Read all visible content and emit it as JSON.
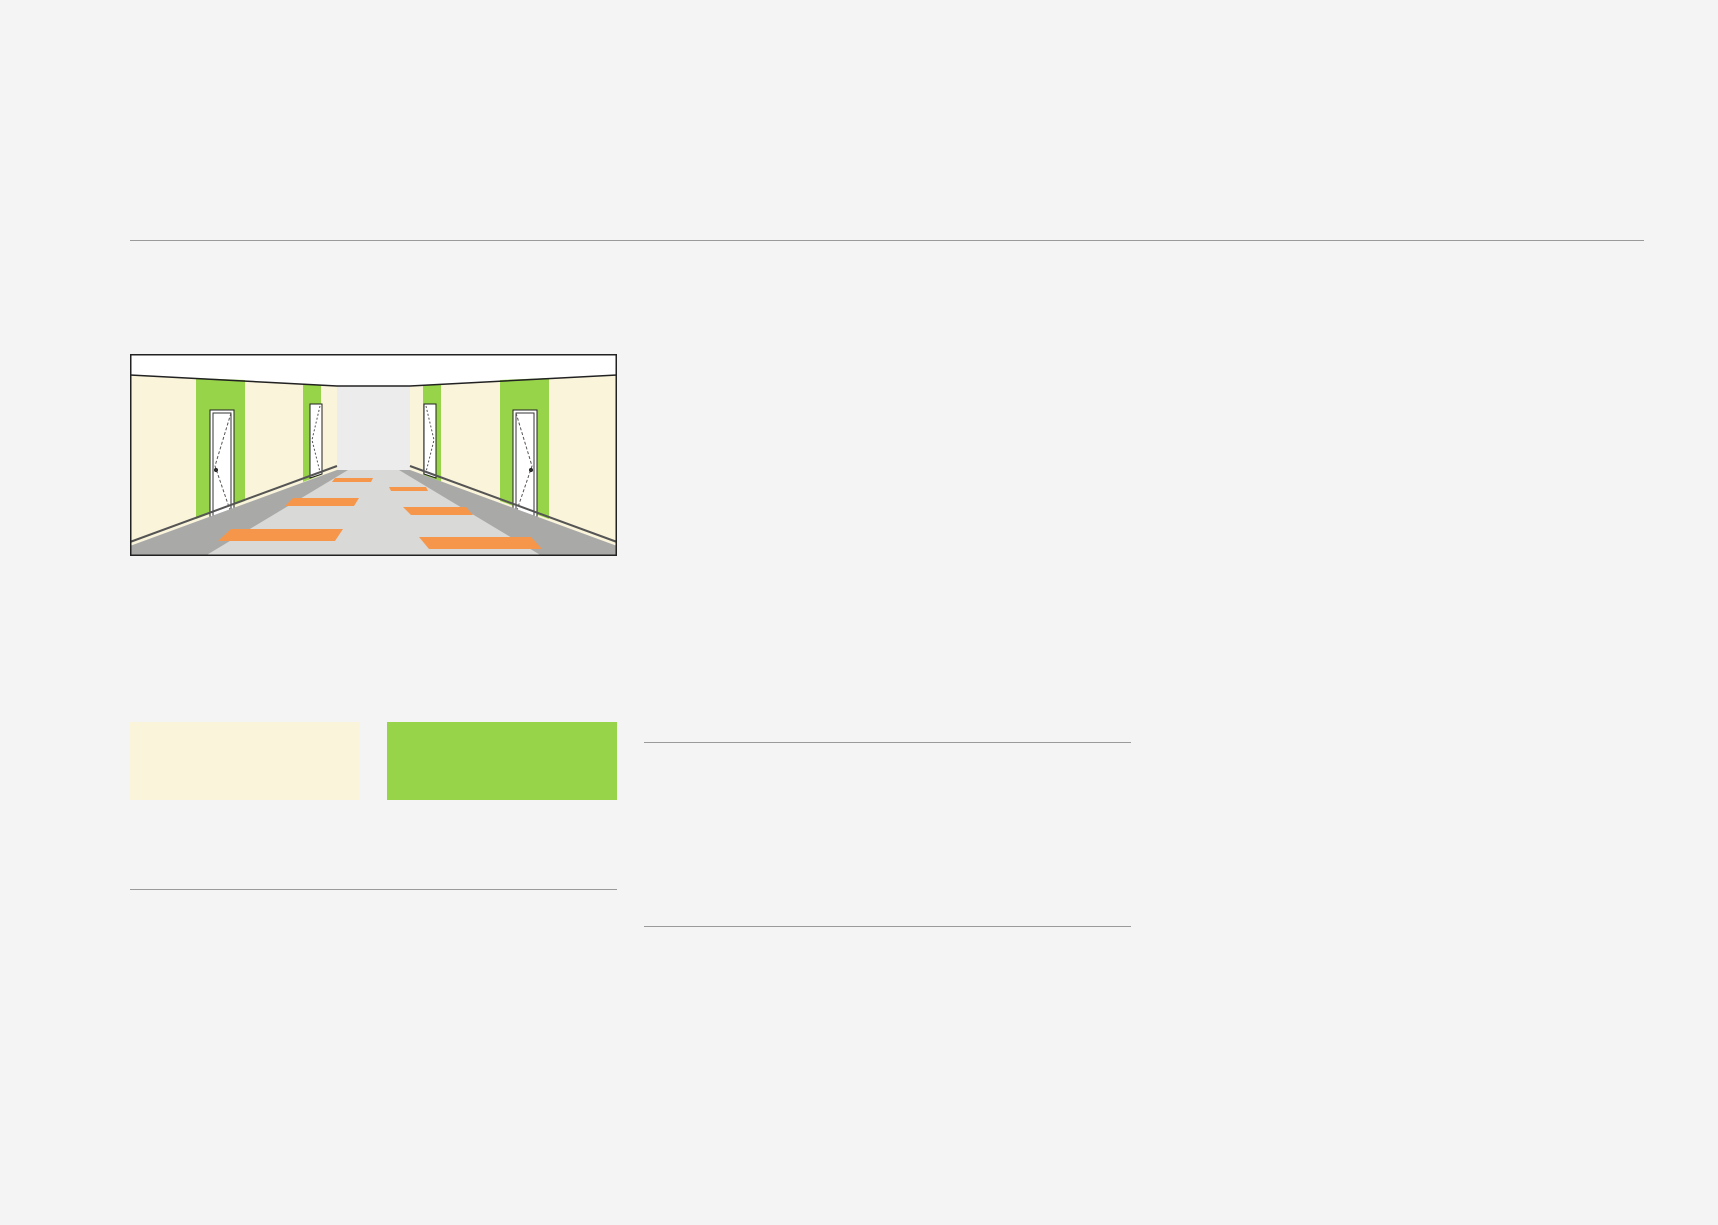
{
  "colors": {
    "background": "#f4f4f4",
    "wall": "#f9f4da",
    "accent": "#98d44a",
    "floor": "#d9d9d7",
    "floor_edge": "#a9a9a8",
    "floor_markings": "#f5964b",
    "ceiling": "#ffffff",
    "far_end": "#ececec",
    "door": "#ffffff",
    "rule": "#9a9a9a"
  },
  "swatches": [
    {
      "name": "wall",
      "color": "#f9f4da"
    },
    {
      "name": "accent",
      "color": "#98d44a"
    }
  ],
  "icons": {
    "illustration": "corridor-perspective-illustration"
  }
}
